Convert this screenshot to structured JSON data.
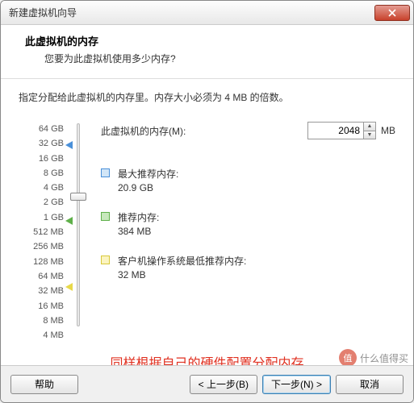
{
  "window": {
    "title": "新建虚拟机向导"
  },
  "header": {
    "title": "此虚拟机的内存",
    "subtitle": "您要为此虚拟机使用多少内存?"
  },
  "instruction": "指定分配给此虚拟机的内存里。内存大小必须为 4 MB 的倍数。",
  "scale": [
    "64 GB",
    "32 GB",
    "16 GB",
    "8 GB",
    "4 GB",
    "2 GB",
    "1 GB",
    "512 MB",
    "256 MB",
    "128 MB",
    "64 MB",
    "32 MB",
    "16 MB",
    "8 MB",
    "4 MB"
  ],
  "memory": {
    "label": "此虚拟机的内存(M):",
    "value": "2048",
    "unit": "MB"
  },
  "markers": {
    "max": {
      "color": "#4a90d9",
      "label": "最大推荐内存:",
      "value": "20.9 GB"
    },
    "rec": {
      "color": "#5fb04a",
      "label": "推荐内存:",
      "value": "384 MB"
    },
    "min": {
      "color": "#e8d94a",
      "label": "客户机操作系统最低推荐内存:",
      "value": "32 MB"
    }
  },
  "annotation": "同样根据自己的硬件配置分配内存",
  "buttons": {
    "help": "帮助",
    "back": "< 上一步(B)",
    "next": "下一步(N) >",
    "cancel": "取消"
  },
  "watermark": {
    "icon": "值",
    "text": "什么值得买"
  }
}
